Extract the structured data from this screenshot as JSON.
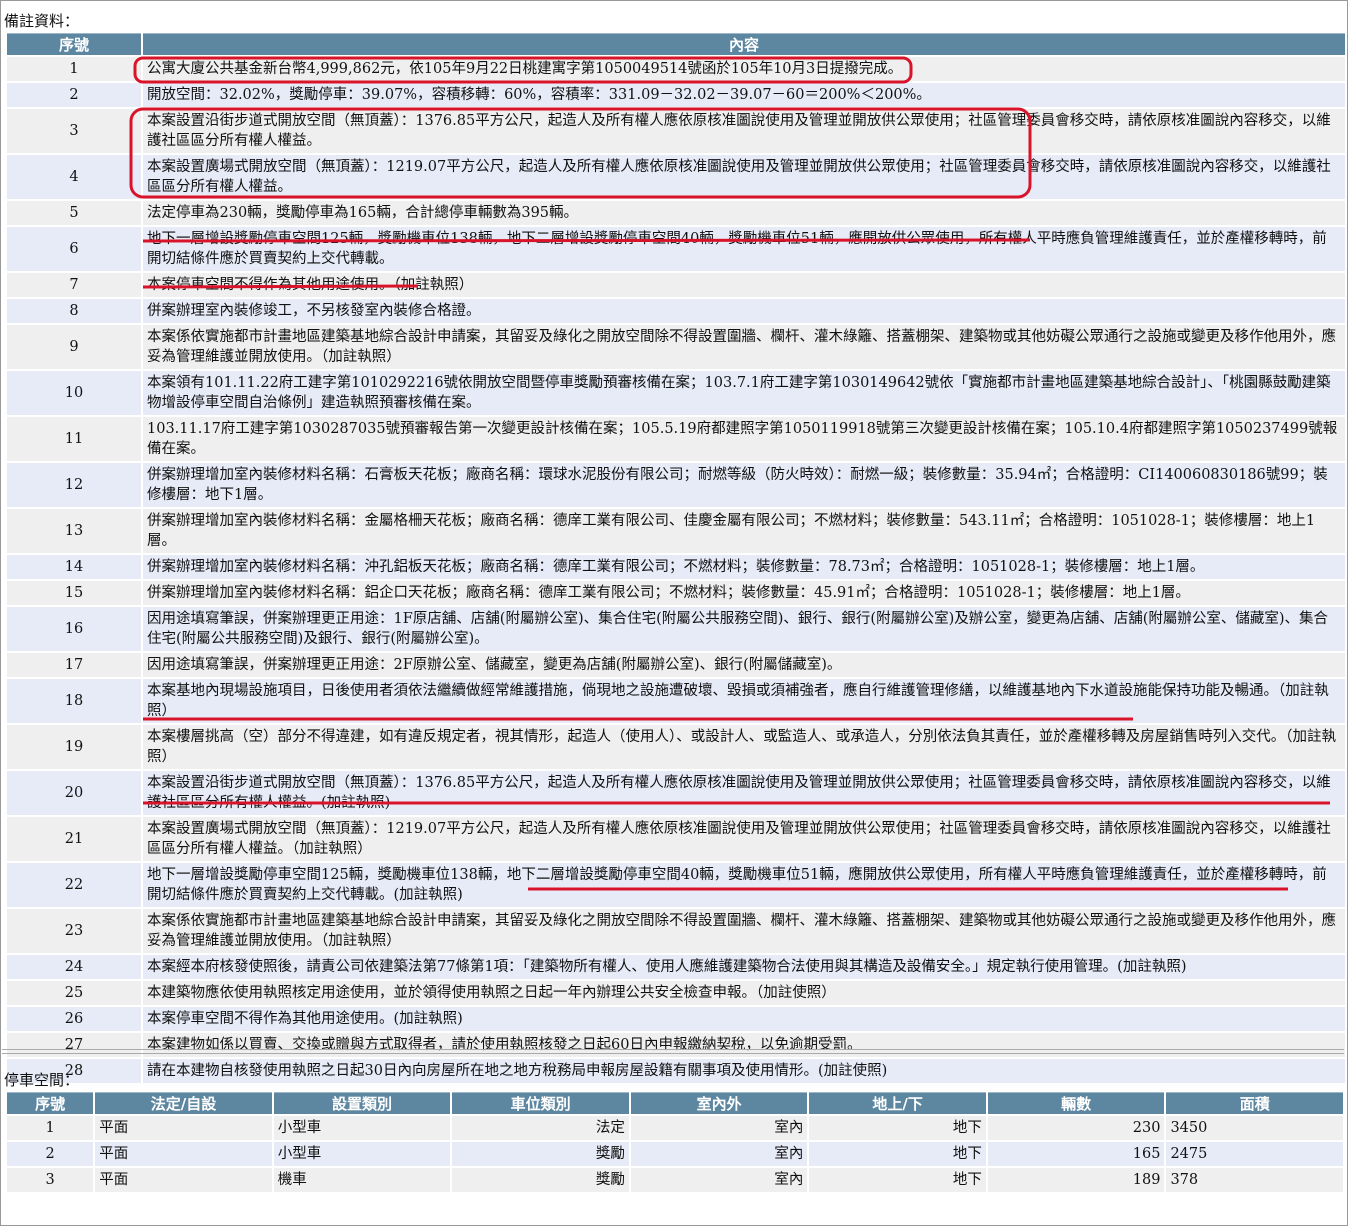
{
  "notes": {
    "title": "備註資料：",
    "headers": [
      "序號",
      "內容"
    ],
    "rows": [
      {
        "no": "1",
        "text": "公寓大廈公共基金新台幣4,999,862元，依105年9月22日桃建寓字第1050049514號函於105年10月3日提撥完成。"
      },
      {
        "no": "2",
        "text": "開放空間：32.02%，獎勵停車：39.07%，容積移轉：60%，容積率：331.09－32.02－39.07－60＝200%＜200%。"
      },
      {
        "no": "3",
        "text": "本案設置沿街步道式開放空間（無頂蓋）：1376.85平方公尺，起造人及所有權人應依原核准圖說使用及管理並開放供公眾使用；社區管理委員會移交時，請依原核准圖說內容移交，以維護社區區分所有權人權益。"
      },
      {
        "no": "4",
        "text": "本案設置廣場式開放空間（無頂蓋）：1219.07平方公尺，起造人及所有權人應依原核准圖說使用及管理並開放供公眾使用；社區管理委員會移交時，請依原核准圖說內容移交，以維護社區區分所有權人權益。"
      },
      {
        "no": "5",
        "text": "法定停車為230輛，獎勵停車為165輛，合計總停車輛數為395輛。"
      },
      {
        "no": "6",
        "text": "地下一層增設獎勵停車空間125輛，獎勵機車位138輛，地下二層增設獎勵停車空間40輛，獎勵機車位51輛，應開放供公眾使用，所有權人平時應負管理維護責任，並於產權移轉時，前開切結條件應於買賣契約上交代轉載。"
      },
      {
        "no": "7",
        "text": "本案停車空間不得作為其他用途使用。（加註執照）"
      },
      {
        "no": "8",
        "text": "併案辦理室內裝修竣工，不另核發室內裝修合格證。"
      },
      {
        "no": "9",
        "text": "本案係依實施都市計畫地區建築基地綜合設計申請案，其留妥及綠化之開放空間除不得設置圍牆、欄杆、灌木綠籬、搭蓋棚架、建築物或其他妨礙公眾通行之設施或變更及移作他用外，應妥為管理維護並開放使用。（加註執照）"
      },
      {
        "no": "10",
        "text": "本案領有101.11.22府工建字第1010292216號依開放空間暨停車獎勵預審核備在案；103.7.1府工建字第1030149642號依「實施都市計畫地區建築基地綜合設計」、「桃園縣鼓勵建築物增設停車空間自治條例」建造執照預審核備在案。"
      },
      {
        "no": "11",
        "text": "103.11.17府工建字第1030287035號預審報告第一次變更設計核備在案；105.5.19府都建照字第1050119918號第三次變更設計核備在案；105.10.4府都建照字第1050237499號報備在案。"
      },
      {
        "no": "12",
        "text": "併案辦理增加室內裝修材料名稱：石膏板天花板；廠商名稱：環球水泥股份有限公司；耐燃等級（防火時效）：耐燃一級；裝修數量：35.94㎡；合格證明：CI140060830186號99；裝修樓層：地下1層。"
      },
      {
        "no": "13",
        "text": "併案辦理增加室內裝修材料名稱：金屬格柵天花板；廠商名稱：德庠工業有限公司、佳慶金屬有限公司；不燃材料；裝修數量：543.11㎡；合格證明：1051028-1；裝修樓層：地上1層。"
      },
      {
        "no": "14",
        "text": "併案辦理增加室內裝修材料名稱：沖孔鋁板天花板；廠商名稱：德庠工業有限公司；不燃材料；裝修數量：78.73㎡；合格證明：1051028-1；裝修樓層：地上1層。"
      },
      {
        "no": "15",
        "text": "併案辦理增加室內裝修材料名稱：鋁企口天花板；廠商名稱：德庠工業有限公司；不燃材料；裝修數量：45.91㎡；合格證明：1051028-1；裝修樓層：地上1層。"
      },
      {
        "no": "16",
        "text": "因用途填寫筆誤，併案辦理更正用途：1F原店舖、店舖(附屬辦公室)、集合住宅(附屬公共服務空間)、銀行、銀行(附屬辦公室)及辦公室，變更為店舖、店舖(附屬辦公室、儲藏室)、集合住宅(附屬公共服務空間)及銀行、銀行(附屬辦公室)。"
      },
      {
        "no": "17",
        "text": "因用途填寫筆誤，併案辦理更正用途：2F原辦公室、儲藏室，變更為店舖(附屬辦公室)、銀行(附屬儲藏室)。"
      },
      {
        "no": "18",
        "text": "本案基地內現場設施項目，日後使用者須依法繼續做經常維護措施，倘現地之設施遭破壞、毀損或須補強者，應自行維護管理修繕，以維護基地內下水道設施能保持功能及暢通。（加註執照）"
      },
      {
        "no": "19",
        "text": "本案樓層挑高（空）部分不得違建，如有違反規定者，視其情形，起造人（使用人）、或設計人、或監造人、或承造人，分別依法負其責任，並於產權移轉及房屋銷售時列入交代。（加註執照）"
      },
      {
        "no": "20",
        "text": "本案設置沿街步道式開放空間（無頂蓋）：1376.85平方公尺，起造人及所有權人應依原核准圖說使用及管理並開放供公眾使用；社區管理委員會移交時，請依原核准圖說內容移交，以維護社區區分所有權人權益。(加註執照)"
      },
      {
        "no": "21",
        "text": "本案設置廣場式開放空間（無頂蓋）：1219.07平方公尺，起造人及所有權人應依原核准圖說使用及管理並開放供公眾使用；社區管理委員會移交時，請依原核准圖說內容移交，以維護社區區分所有權人權益。（加註執照）"
      },
      {
        "no": "22",
        "text": "地下一層增設獎勵停車空間125輛，獎勵機車位138輛，地下二層增設獎勵停車空間40輛，獎勵機車位51輛，應開放供公眾使用，所有權人平時應負管理維護責任，並於產權移轉時，前開切結條件應於買賣契約上交代轉載。(加註執照)"
      },
      {
        "no": "23",
        "text": "本案係依實施都市計畫地區建築基地綜合設計申請案，其留妥及綠化之開放空間除不得設置圍牆、欄杆、灌木綠籬、搭蓋棚架、建築物或其他妨礙公眾通行之設施或變更及移作他用外，應妥為管理維護並開放使用。（加註執照）"
      },
      {
        "no": "24",
        "text": "本案經本府核發使照後，請責公司依建築法第77條第1項：「建築物所有權人、使用人應維護建築物合法使用與其構造及設備安全。」規定執行使用管理。(加註執照)"
      },
      {
        "no": "25",
        "text": "本建築物應依使用執照核定用途使用，並於領得使用執照之日起一年內辦理公共安全檢查申報。（加註使照）"
      },
      {
        "no": "26",
        "text": "本案停車空間不得作為其他用途使用。(加註執照)"
      },
      {
        "no": "27",
        "text": "本案建物如係以買賣、交換或贈與方式取得者，請於使用執照核發之日起60日內申報繳納契稅，以免逾期受罰。"
      },
      {
        "no": "28",
        "text": "請在本建物自核發使用執照之日起30日內向房屋所在地之地方稅務局申報房屋設籍有關事項及使用情形。(加註使照)"
      }
    ]
  },
  "parking": {
    "title": "停車空間：",
    "headers": [
      "序號",
      "法定/自設",
      "設置類別",
      "車位類別",
      "室內外",
      "地上/下",
      "輛數",
      "面積"
    ],
    "rows": [
      {
        "no": "1",
        "legal": "平面",
        "type": "小型車",
        "cat": "法定",
        "inout": "室內",
        "level": "地下",
        "count": "230",
        "area": "3450"
      },
      {
        "no": "2",
        "legal": "平面",
        "type": "小型車",
        "cat": "獎勵",
        "inout": "室內",
        "level": "地下",
        "count": "165",
        "area": "2475"
      },
      {
        "no": "3",
        "legal": "平面",
        "type": "機車",
        "cat": "獎勵",
        "inout": "室內",
        "level": "地下",
        "count": "189",
        "area": "378"
      }
    ]
  },
  "annotation_color": "#d9142a"
}
